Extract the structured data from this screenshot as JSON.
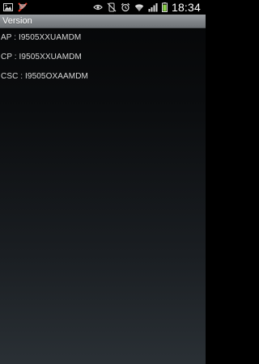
{
  "status_bar": {
    "time": "18:34",
    "left_icons": [
      "gallery-icon",
      "usb-debug-icon"
    ],
    "right_icons": [
      "eye-icon",
      "silent-mode-icon",
      "alarm-icon",
      "wifi-icon",
      "signal-icon",
      "battery-icon"
    ],
    "battery_level": 0.85,
    "colors": {
      "status_bg": "#000000",
      "battery": "#8bd34a",
      "debug_icon": "#e23a2a"
    }
  },
  "title_bar": {
    "title": "Version"
  },
  "lines": [
    {
      "text": "AP : I9505XXUAMDM"
    },
    {
      "text": "CP : I9505XXUAMDM"
    },
    {
      "text": "CSC : I9505OXAAMDM"
    }
  ]
}
